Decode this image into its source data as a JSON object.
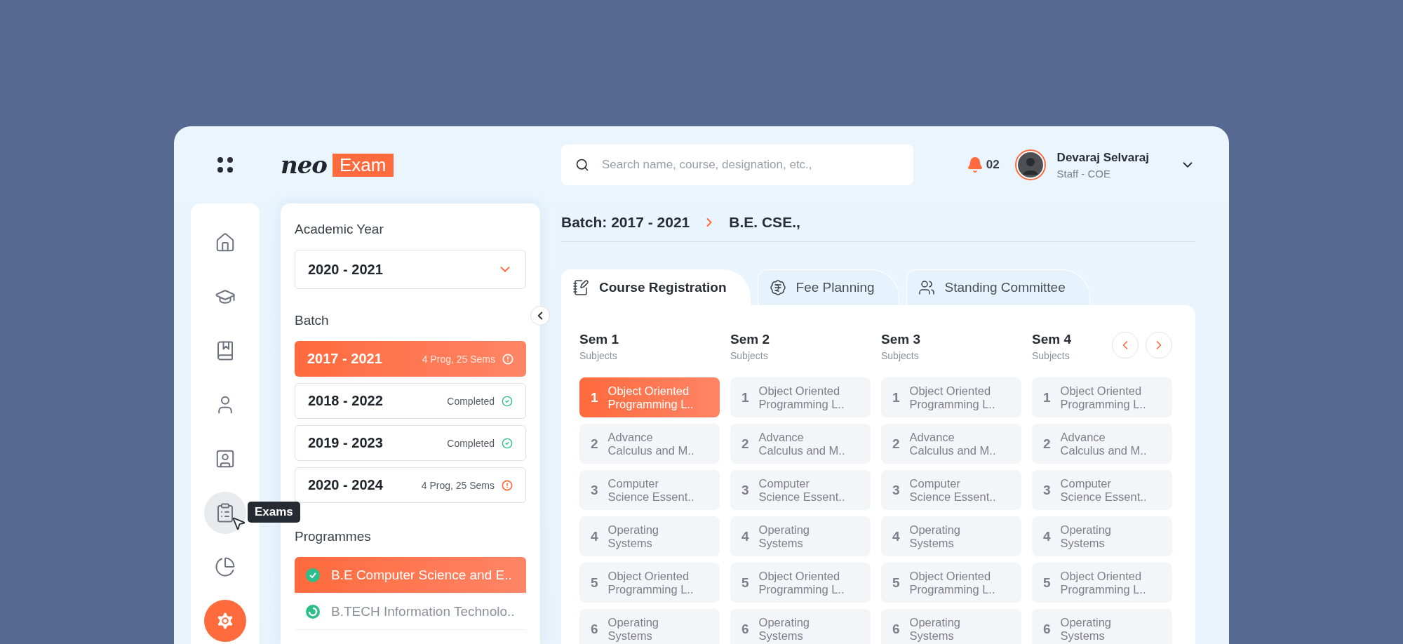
{
  "header": {
    "logo": {
      "word": "neo",
      "badge": "Exam"
    },
    "search": {
      "placeholder": "Search name, course, designation, etc.,"
    },
    "notifications": "02",
    "user": {
      "name": "Devaraj Selvaraj",
      "role": "Staff - COE"
    }
  },
  "sidebar": {
    "items": [
      {
        "selected": false,
        "hovered": false
      },
      {
        "selected": false,
        "hovered": false
      },
      {
        "selected": false,
        "hovered": false
      },
      {
        "selected": false,
        "hovered": false
      },
      {
        "selected": false,
        "hovered": false
      },
      {
        "selected": false,
        "hovered": true,
        "tooltip": "Exams"
      },
      {
        "selected": false,
        "hovered": false
      },
      {
        "selected": true,
        "hovered": false
      }
    ]
  },
  "filters": {
    "academic_year": {
      "label": "Academic Year",
      "value": "2020 - 2021"
    },
    "batch": {
      "label": "Batch",
      "items": [
        {
          "label": "2017 - 2021",
          "status": "4 Prog, 25 Sems",
          "kind": "pending",
          "selected": true
        },
        {
          "label": "2018 - 2022",
          "status": "Completed",
          "kind": "completed",
          "selected": false
        },
        {
          "label": "2019 - 2023",
          "status": "Completed",
          "kind": "completed",
          "selected": false
        },
        {
          "label": "2020 - 2024",
          "status": "4 Prog, 25 Sems",
          "kind": "pending",
          "selected": false
        }
      ]
    },
    "programmes": {
      "label": "Programmes",
      "items": [
        {
          "name": "B.E Computer Science and E..",
          "kind": "completed",
          "selected": true
        },
        {
          "name": "B.TECH Information Technolo..",
          "kind": "in_progress",
          "selected": false
        }
      ]
    }
  },
  "breadcrumb": [
    "Batch: 2017 - 2021",
    "B.E. CSE.,"
  ],
  "tabs": [
    {
      "label": "Course Registration",
      "selected": true
    },
    {
      "label": "Fee Planning",
      "selected": false
    },
    {
      "label": "Standing Committee",
      "selected": false
    }
  ],
  "semesters": [
    {
      "title": "Sem 1",
      "subtitle": "Subjects",
      "subjects": [
        {
          "number": "1",
          "name": "Object Oriented Programming L..",
          "selected": true
        },
        {
          "number": "2",
          "name": "Advance Calculus and M..",
          "selected": false
        },
        {
          "number": "3",
          "name": "Computer Science Essent..",
          "selected": false
        },
        {
          "number": "4",
          "name": "Operating Systems",
          "selected": false
        },
        {
          "number": "5",
          "name": "Object Oriented Programming L..",
          "selected": false
        },
        {
          "number": "6",
          "name": "Operating Systems",
          "selected": false
        }
      ]
    },
    {
      "title": "Sem 2",
      "subtitle": "Subjects",
      "subjects": [
        {
          "number": "1",
          "name": "Object Oriented Programming L..",
          "selected": false
        },
        {
          "number": "2",
          "name": "Advance Calculus and M..",
          "selected": false
        },
        {
          "number": "3",
          "name": "Computer Science Essent..",
          "selected": false
        },
        {
          "number": "4",
          "name": "Operating Systems",
          "selected": false
        },
        {
          "number": "5",
          "name": "Object Oriented Programming L..",
          "selected": false
        },
        {
          "number": "6",
          "name": "Operating Systems",
          "selected": false
        }
      ]
    },
    {
      "title": "Sem 3",
      "subtitle": "Subjects",
      "subjects": [
        {
          "number": "1",
          "name": "Object Oriented Programming L..",
          "selected": false
        },
        {
          "number": "2",
          "name": "Advance Calculus and M..",
          "selected": false
        },
        {
          "number": "3",
          "name": "Computer Science Essent..",
          "selected": false
        },
        {
          "number": "4",
          "name": "Operating Systems",
          "selected": false
        },
        {
          "number": "5",
          "name": "Object Oriented Programming L..",
          "selected": false
        },
        {
          "number": "6",
          "name": "Operating Systems",
          "selected": false
        }
      ]
    },
    {
      "title": "Sem 4",
      "subtitle": "Subjects",
      "subjects": [
        {
          "number": "1",
          "name": "Object Oriented Programming L..",
          "selected": false
        },
        {
          "number": "2",
          "name": "Advance Calculus and M..",
          "selected": false
        },
        {
          "number": "3",
          "name": "Computer Science Essent..",
          "selected": false
        },
        {
          "number": "4",
          "name": "Operating Systems",
          "selected": false
        },
        {
          "number": "5",
          "name": "Object Oriented Programming L..",
          "selected": false
        },
        {
          "number": "6",
          "name": "Operating Systems",
          "selected": false
        }
      ]
    }
  ]
}
